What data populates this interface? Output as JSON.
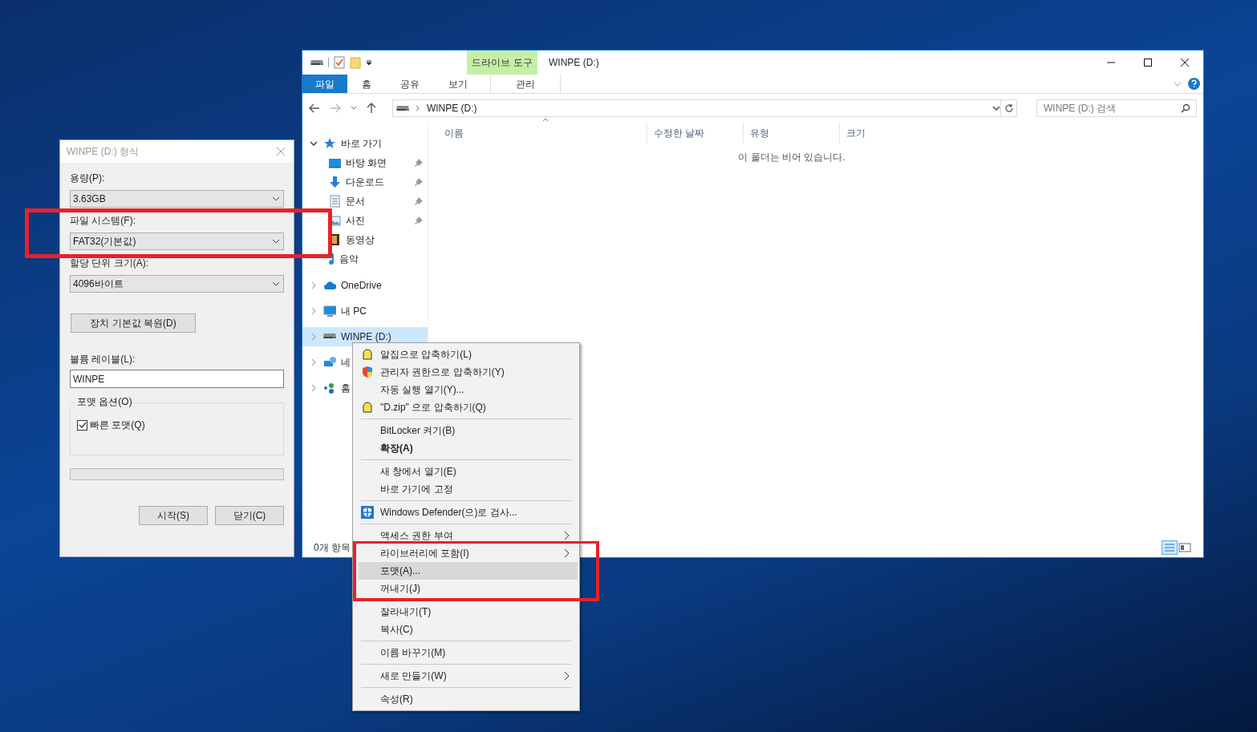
{
  "explorer": {
    "title": "WINPE (D:)",
    "context_tab_group": "드라이브 도구",
    "tabs": [
      {
        "label": "파일",
        "kind": "file"
      },
      {
        "label": "홈",
        "kind": "normal"
      },
      {
        "label": "공유",
        "kind": "normal"
      },
      {
        "label": "보기",
        "kind": "normal"
      },
      {
        "label": "관리",
        "kind": "context"
      }
    ],
    "address": "WINPE (D:)",
    "search": {
      "placeholder": "WINPE (D:) 검색"
    },
    "columns": [
      "이름",
      "수정한 날짜",
      "유형",
      "크기"
    ],
    "empty_message": "이 폴더는 비어 있습니다.",
    "nav": [
      {
        "label": "바로 가기",
        "kind": "star",
        "expanded": true,
        "selected": false,
        "children": [
          {
            "label": "바탕 화면",
            "kind": "desktop",
            "pinned": true
          },
          {
            "label": "다운로드",
            "kind": "download",
            "pinned": true
          },
          {
            "label": "문서",
            "kind": "document",
            "pinned": true
          },
          {
            "label": "사진",
            "kind": "picture",
            "pinned": true
          },
          {
            "label": "동영상",
            "kind": "video",
            "pinned": false
          },
          {
            "label": "음악",
            "kind": "music",
            "pinned": false
          }
        ]
      },
      {
        "label": "OneDrive",
        "kind": "cloud",
        "expanded": false,
        "selected": false
      },
      {
        "label": "내 PC",
        "kind": "pc",
        "expanded": false,
        "selected": false
      },
      {
        "label": "WINPE (D:)",
        "kind": "drive",
        "expanded": false,
        "selected": true
      },
      {
        "label": "네",
        "kind": "network",
        "expanded": false,
        "selected": false
      },
      {
        "label": "홈",
        "kind": "homegroup",
        "expanded": false,
        "selected": false
      }
    ],
    "status": "0개 항목"
  },
  "format_dialog": {
    "title": "WINPE (D:) 형식",
    "fields": [
      {
        "label": "용량(P):",
        "value": "3.63GB"
      },
      {
        "label": "파일 시스템(F):",
        "value": "FAT32(기본값)"
      },
      {
        "label": "할당 단위 크기(A):",
        "value": "4096바이트"
      }
    ],
    "restore_button": "장치 기본값 복원(D)",
    "volume_label": {
      "label": "볼륨 레이블(L):",
      "value": "WINPE"
    },
    "options_group": "포맷 옵션(O)",
    "quick_format": {
      "label": "빠른 포맷(Q)",
      "checked": true
    },
    "progress": {
      "level": 0
    },
    "buttons": [
      "시작(S)",
      "닫기(C)"
    ]
  },
  "context_menu": [
    [
      {
        "label": "알집으로 압축하기(L)",
        "kind": "archive",
        "bold": false,
        "submenu": false,
        "selected": false
      },
      {
        "label": "관리자 권한으로 압축하기(Y)",
        "kind": "admin_archive",
        "bold": false,
        "submenu": false,
        "selected": false
      },
      {
        "label": "자동 실행 열기(Y)...",
        "kind": "plain",
        "bold": false,
        "submenu": false,
        "selected": false
      },
      {
        "label": "\"D.zip\" 으로 압축하기(Q)",
        "kind": "archive",
        "bold": false,
        "submenu": false,
        "selected": false
      }
    ],
    [
      {
        "label": "BitLocker 켜기(B)",
        "kind": "plain",
        "bold": false,
        "submenu": false,
        "selected": false
      },
      {
        "label": "확장(A)",
        "kind": "plain",
        "bold": true,
        "submenu": false,
        "selected": false
      }
    ],
    [
      {
        "label": "새 창에서 열기(E)",
        "kind": "plain",
        "bold": false,
        "submenu": false,
        "selected": false
      },
      {
        "label": "바로 가기에 고정",
        "kind": "plain",
        "bold": false,
        "submenu": false,
        "selected": false
      }
    ],
    [
      {
        "label": "Windows Defender(으)로 검사...",
        "kind": "scan",
        "bold": false,
        "submenu": false,
        "selected": false
      }
    ],
    [
      {
        "label": "액세스 권한 부여",
        "kind": "plain",
        "bold": false,
        "submenu": true,
        "selected": false
      },
      {
        "label": "라이브러리에 포함(I)",
        "kind": "plain",
        "bold": false,
        "submenu": true,
        "selected": false
      },
      {
        "label": "포맷(A)...",
        "kind": "plain",
        "bold": false,
        "submenu": false,
        "selected": true
      },
      {
        "label": "꺼내기(J)",
        "kind": "plain",
        "bold": false,
        "submenu": false,
        "selected": false
      }
    ],
    [
      {
        "label": "잘라내기(T)",
        "kind": "plain",
        "bold": false,
        "submenu": false,
        "selected": false
      },
      {
        "label": "복사(C)",
        "kind": "plain",
        "bold": false,
        "submenu": false,
        "selected": false
      }
    ],
    [
      {
        "label": "이름 바꾸기(M)",
        "kind": "plain",
        "bold": false,
        "submenu": false,
        "selected": false
      }
    ],
    [
      {
        "label": "새로 만들기(W)",
        "kind": "plain",
        "bold": false,
        "submenu": true,
        "selected": false
      }
    ],
    [
      {
        "label": "속성(R)",
        "kind": "plain",
        "bold": false,
        "submenu": false,
        "selected": false
      }
    ]
  ]
}
